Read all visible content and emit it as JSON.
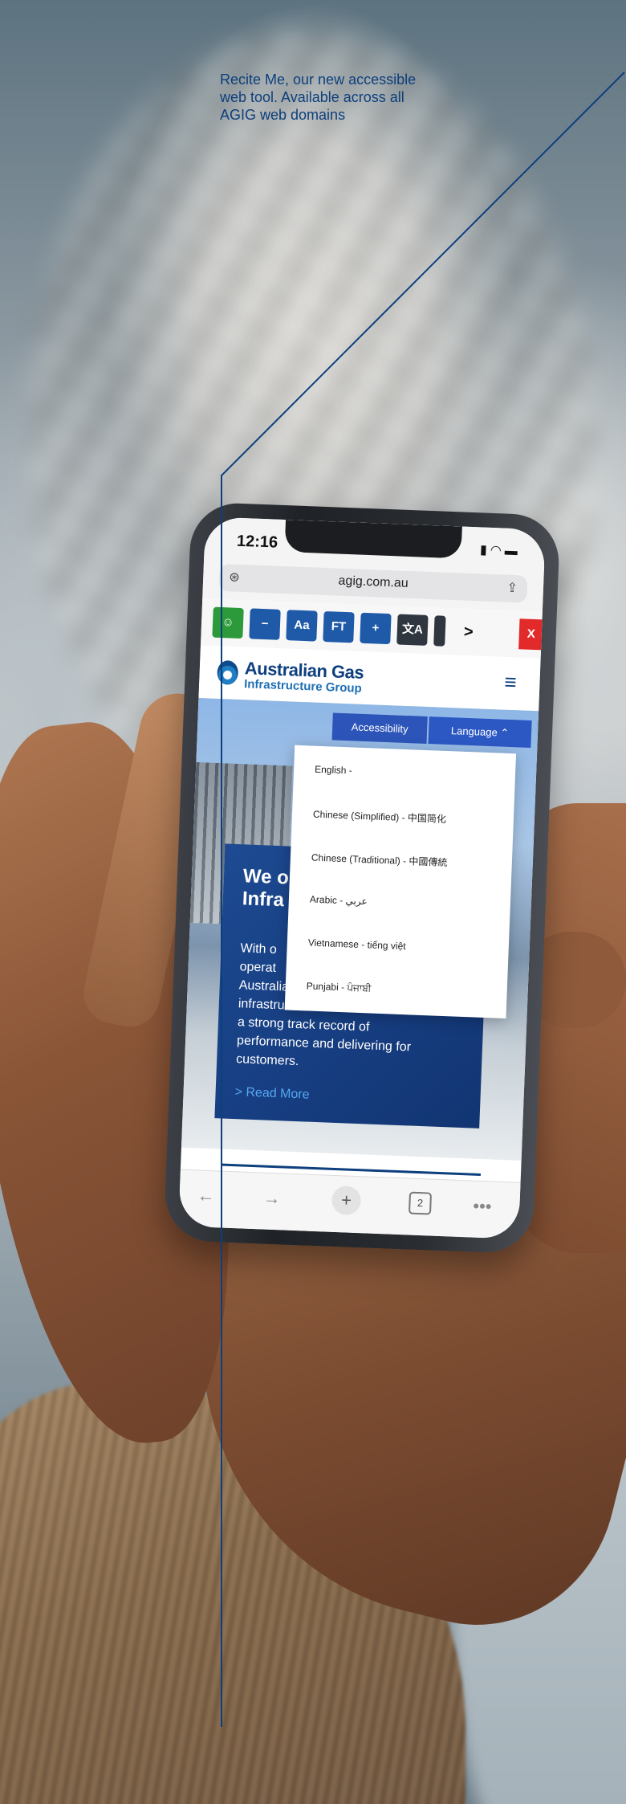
{
  "caption": {
    "line1": "Recite Me, our new accessible",
    "line2": "web tool. Available across all",
    "line3": "AGIG web domains"
  },
  "phone": {
    "status": {
      "time": "12:16",
      "icons": "signal-icon wifi-icon battery-icon"
    },
    "browser": {
      "url": "agig.com.au"
    },
    "recite_toolbar": {
      "buttons": [
        "Aa",
        "FT",
        "+",
        ">",
        "X"
      ]
    },
    "site": {
      "logo_line1": "Australian Gas",
      "logo_line2": "Infrastructure Group",
      "tabs": {
        "accessibility": "Accessibility",
        "language": "Language"
      },
      "languages": [
        "English -",
        "Chinese (Simplified) - 中国简化",
        "Chinese (Traditional) - 中國傳統",
        "Arabic - عربي",
        "Vietnamese - tiếng việt",
        "Punjabi - ਪੰਜਾਬੀ"
      ],
      "promo": {
        "title_line1": "We o",
        "title_line2": "Infra",
        "body_line1": "With o",
        "body_line2": "operat",
        "body_line3": "Australia's largest energy",
        "body_line4": "infrastructure businesses. We have",
        "body_line5": "a strong track record of",
        "body_line6": "performance and delivering for",
        "body_line7": "customers.",
        "link": "> Read More"
      }
    },
    "bottom_toolbar": {
      "tab_count": "2"
    }
  },
  "colors": {
    "brand_navy": "#0e3f7e",
    "brand_blue": "#1e5aa8",
    "callout_line": "#0d3f7c"
  }
}
